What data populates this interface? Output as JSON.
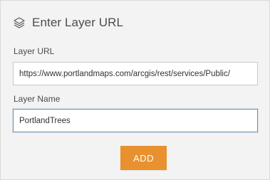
{
  "header": {
    "icon": "layers-icon",
    "title": "Enter Layer URL"
  },
  "layer_url": {
    "label": "Layer URL",
    "value": "https://www.portlandmaps.com/arcgis/rest/services/Public/"
  },
  "layer_name": {
    "label": "Layer Name",
    "value": "PortlandTrees"
  },
  "add_button": {
    "label": "ADD"
  },
  "colors": {
    "panel_background": "#f3f3f3",
    "text": "#4c4c4c",
    "accent_button": "#e8912e",
    "focused_border": "#6b8fb2"
  }
}
